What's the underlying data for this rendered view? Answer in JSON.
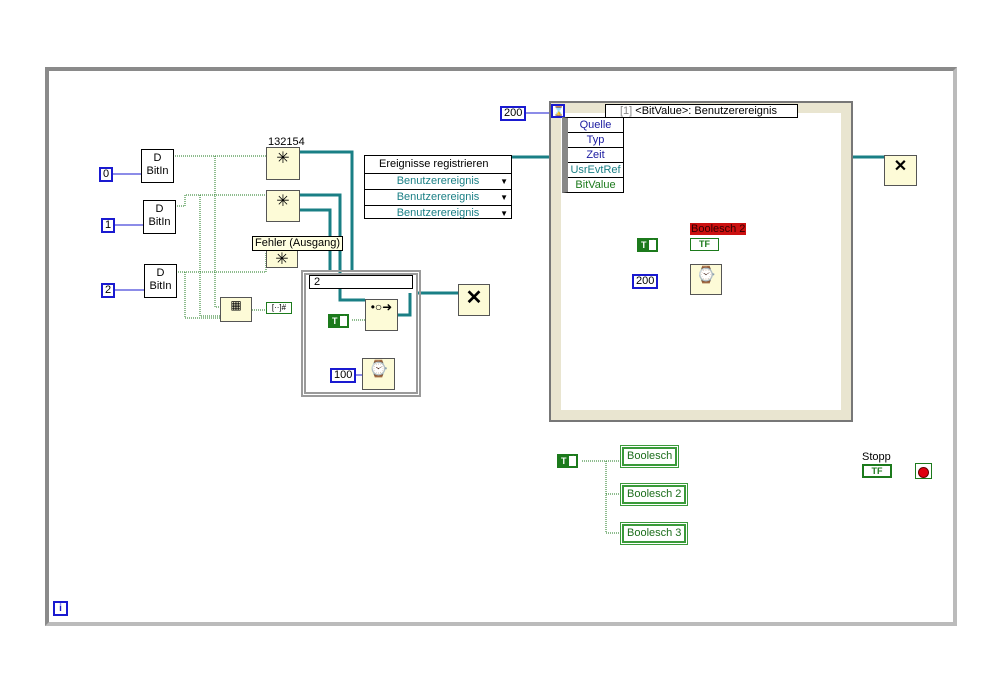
{
  "constants": {
    "c0": "0",
    "c1": "1",
    "c2": "2",
    "c100": "100",
    "timeout": "200",
    "wait200": "200"
  },
  "bitin": {
    "line1": "D",
    "line2": "BitIn"
  },
  "create_event_label": "132154",
  "tooltip": "Fehler (Ausgang)",
  "register": {
    "title": "Ereignisse registrieren",
    "rows": [
      "Benutzerereignis",
      "Benutzerereignis",
      "Benutzerereignis"
    ]
  },
  "case_selector": "2",
  "event_selector": {
    "index": "[1]",
    "label": "<BitValue>: Benutzerereignis"
  },
  "event_data": [
    "Quelle",
    "Typ",
    "Zeit",
    "UsrEvtRef",
    "BitValue"
  ],
  "local_var_label": "Boolesch 2",
  "local_var_text": "TF",
  "true_const": "T",
  "indicators": [
    "Boolesch",
    "Boolesch 2",
    "Boolesch 3"
  ],
  "stop": {
    "label": "Stopp",
    "terminal": "TF"
  },
  "info": "i",
  "colors": {
    "numeric_wire": "#1a1ad0",
    "boolean_wire": "#1c7a1c",
    "refnum_wire": "#1a7f85",
    "local_var_label_bg": "#cc1010"
  }
}
